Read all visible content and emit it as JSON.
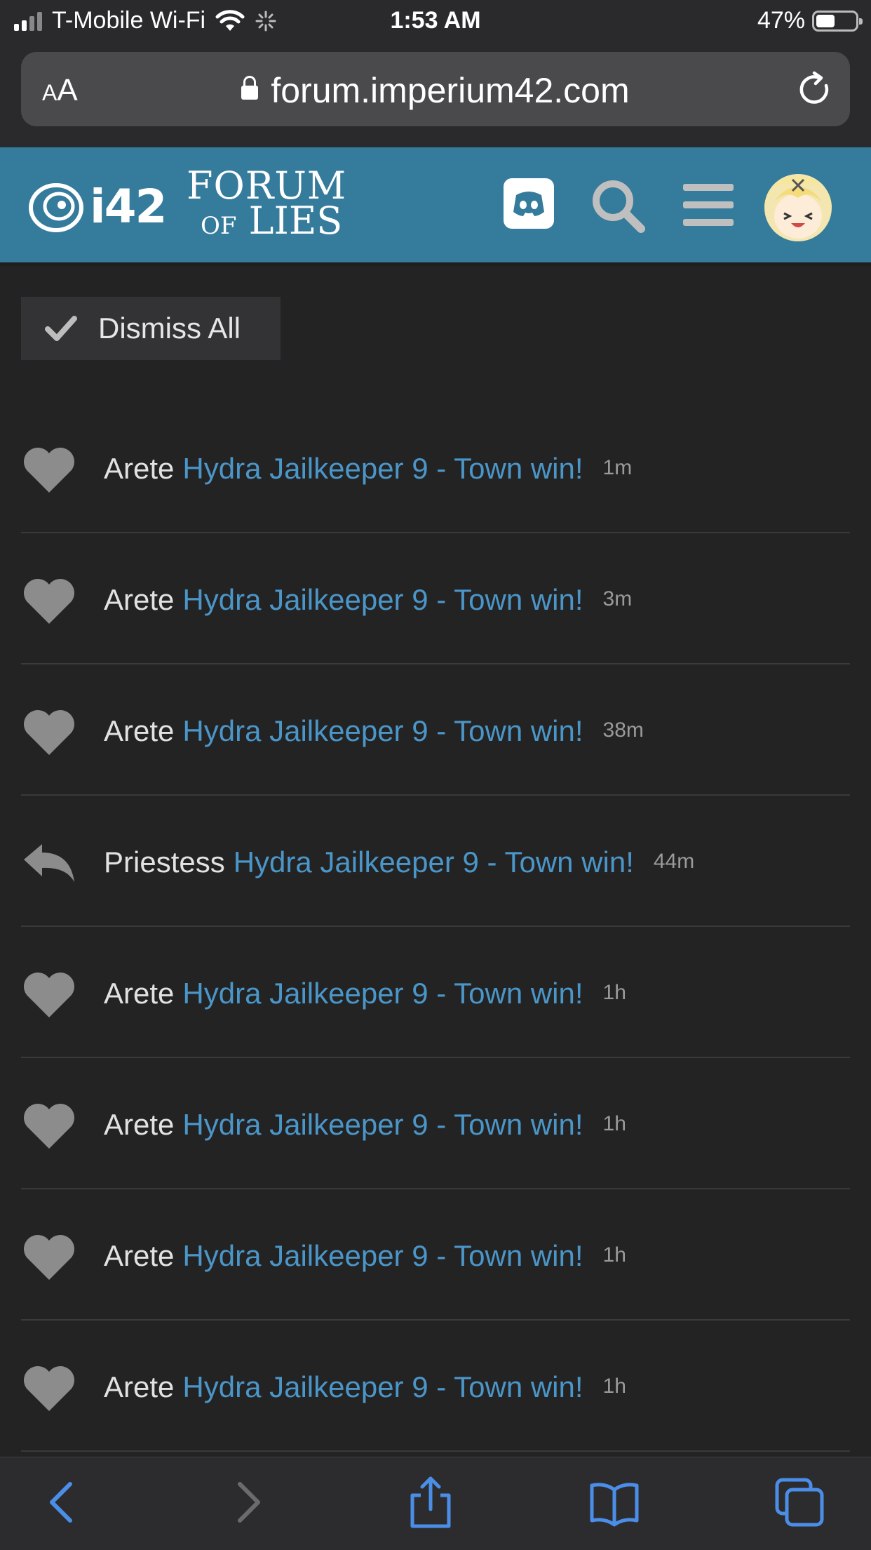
{
  "status": {
    "carrier": "T-Mobile Wi-Fi",
    "time": "1:53 AM",
    "battery": "47%"
  },
  "browser": {
    "text_size": "AA",
    "url": "forum.imperium42.com"
  },
  "header": {
    "logo_i42": "i42",
    "logo_line1": "FORUM",
    "logo_line2a": "OF",
    "logo_line2b": "LIES"
  },
  "dismiss_label": "Dismiss All",
  "notifications": [
    {
      "user": "Arete",
      "thread": "Hydra Jailkeeper 9 - Town win!",
      "age": "1m",
      "icon": "heart-icon"
    },
    {
      "user": "Arete",
      "thread": "Hydra Jailkeeper 9 - Town win!",
      "age": "3m",
      "icon": "heart-icon"
    },
    {
      "user": "Arete",
      "thread": "Hydra Jailkeeper 9 - Town win!",
      "age": "38m",
      "icon": "heart-icon"
    },
    {
      "user": "Priestess",
      "thread": "Hydra Jailkeeper 9 - Town win!",
      "age": "44m",
      "icon": "reply-icon"
    },
    {
      "user": "Arete",
      "thread": "Hydra Jailkeeper 9 - Town win!",
      "age": "1h",
      "icon": "heart-icon"
    },
    {
      "user": "Arete",
      "thread": "Hydra Jailkeeper 9 - Town win!",
      "age": "1h",
      "icon": "heart-icon"
    },
    {
      "user": "Arete",
      "thread": "Hydra Jailkeeper 9 - Town win!",
      "age": "1h",
      "icon": "heart-icon"
    },
    {
      "user": "Arete",
      "thread": "Hydra Jailkeeper 9 - Town win!",
      "age": "1h",
      "icon": "heart-icon"
    }
  ],
  "colors": {
    "header_bg": "#357b9c",
    "link": "#4b96c8",
    "page_bg": "#232324"
  }
}
